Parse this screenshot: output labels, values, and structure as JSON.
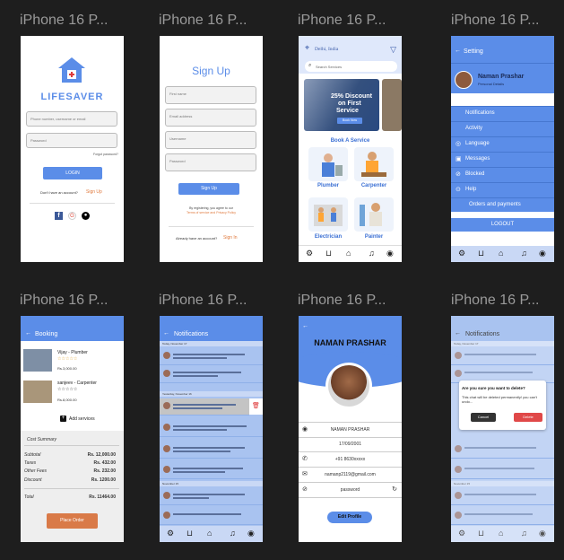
{
  "frames": [
    "iPhone 16 P...",
    "iPhone 16 P...",
    "iPhone 16 P...",
    "iPhone 16 P...",
    "iPhone 16 P...",
    "iPhone 16 P...",
    "iPhone 16 P...",
    "iPhone 16 P..."
  ],
  "login": {
    "title": "LIFESAVER",
    "user_placeholder": "Phone number, username or email",
    "password_placeholder": "Password",
    "forgot": "Forgot password?",
    "login_btn": "LOGIN",
    "no_account": "Don't have an account?",
    "signup_link": "Sign Up"
  },
  "signup": {
    "title": "Sign Up",
    "fields": [
      "First name",
      "Email address",
      "Username",
      "Password"
    ],
    "btn": "Sign Up",
    "terms1": "By registering, you agree to our",
    "terms2": "Terms of service and Privacy Policy",
    "have_account": "Already have an account?",
    "signin_link": "Sign In"
  },
  "home": {
    "location": "Delhi, India",
    "search_placeholder": "Search Services",
    "promo_line1": "25% Discount",
    "promo_line2": "on First",
    "promo_line3": "Service",
    "promo_btn": "Book Now",
    "section": "Book A Service",
    "cats": [
      "Plumber",
      "Carpenter",
      "Electrician",
      "Painter"
    ]
  },
  "settings": {
    "title": "Setting",
    "name": "Naman Prashar",
    "sub": "Personal Details",
    "items": [
      "Notifications",
      "Activity",
      "Language",
      "Messages",
      "Blocked",
      "Help",
      "Orders and payments"
    ],
    "logout": "LOGOUT"
  },
  "booking": {
    "title": "Booking",
    "items": [
      {
        "name": "Vijay - Plumber",
        "price": "Rs.3,000.00",
        "stars": "☆☆☆☆☆"
      },
      {
        "name": "sanjeev - Carpenter",
        "price": "Rs.8,000.00",
        "stars": "☆☆☆☆☆"
      }
    ],
    "add": "Add services",
    "summary_title": "Cost Summary",
    "rows": [
      {
        "label": "Subtotal",
        "value": "Rs. 12,000.00"
      },
      {
        "label": "Taxes",
        "value": "Rs. 432.00"
      },
      {
        "label": "Other Fees",
        "value": "Rs. 232.00"
      },
      {
        "label": "Discount",
        "value": "Rs. 1200.00"
      }
    ],
    "total_label": "Total",
    "total_value": "Rs. 11464.00",
    "place_order": "Place Order"
  },
  "notifications": {
    "title": "Notifications",
    "days": [
      "Today, November 17",
      "Yesterday, November 16",
      "November 15"
    ]
  },
  "profile": {
    "name": "NAMAN PRASHAR",
    "fields": [
      "NAMAN PRASHAR",
      "17/09/2001",
      "+91 8630xxxxx",
      "namanp2119@gmail.com",
      "password"
    ],
    "btn": "Edit Profile"
  },
  "delete_dialog": {
    "title": "Are you sure you want to delete?",
    "body": "This chat will be deleted permanently! you can't undo...",
    "cancel": "Cancel",
    "delete": "Delete"
  },
  "colors": {
    "accent": "#5b8de8",
    "orange": "#e07a3e",
    "canvas": "#1e1e1e"
  }
}
